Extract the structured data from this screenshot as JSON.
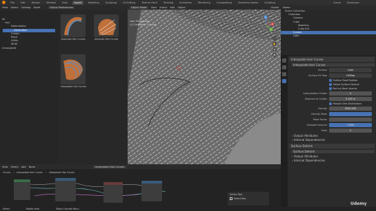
{
  "topbar": {
    "menus": [
      "File",
      "Edit",
      "Render",
      "Window",
      "Help"
    ],
    "tabs": [
      "Layout",
      "Modeling",
      "Sculpting",
      "UV Editing",
      "Texture Paint",
      "Shading",
      "Animation",
      "Rendering",
      "Compositing",
      "Geometry Nodes",
      "Scripting"
    ],
    "active_tab": "Layout",
    "scene": "Scene",
    "view_layer": "ViewLayer"
  },
  "asset_browser": {
    "header_items": [
      "View",
      "Select",
      "Catalog",
      "Asset"
    ],
    "follow_prefs": "Follow Preferences",
    "tree": [
      {
        "label": "All",
        "indent": 0
      },
      {
        "label": "Hair",
        "indent": 1
      },
      {
        "label": "Deformation",
        "indent": 2
      },
      {
        "label": "Generation",
        "indent": 2,
        "selected": true
      },
      {
        "label": "Guides",
        "indent": 2
      },
      {
        "label": "Read",
        "indent": 2
      },
      {
        "label": "Utility",
        "indent": 2
      },
      {
        "label": "Write",
        "indent": 2
      },
      {
        "label": "Unassigned",
        "indent": 0
      }
    ],
    "assets": [
      "Duplicate Hair Curves",
      "Generate Hair Curves",
      "Interpolate Hair Curves"
    ]
  },
  "viewport": {
    "mode": "Object Mode",
    "menus": [
      "View",
      "Select",
      "Add",
      "Object"
    ],
    "transform": "Global",
    "perspective": "User Perspective",
    "collection": "(1) Collection | Curves",
    "axes": {
      "x": "X",
      "y": "Y",
      "z": "Z"
    }
  },
  "outliner": {
    "title": "Name",
    "items": [
      {
        "label": "Scene Collection",
        "indent": 0
      },
      {
        "label": "Collection",
        "indent": 1
      },
      {
        "label": "Camera",
        "indent": 2
      },
      {
        "label": "Cube",
        "indent": 2
      },
      {
        "label": "Modifiers",
        "indent": 3
      },
      {
        "label": "Cube.001",
        "indent": 3
      },
      {
        "label": "Curves",
        "indent": 2,
        "selected": true
      },
      {
        "label": "Light",
        "indent": 2
      }
    ]
  },
  "properties": {
    "modifier_name": "Interpolate Hair Curves",
    "sub_name": "Interpolate Hair Curves",
    "surface_label": "Surface",
    "surface_value": "Cube",
    "uv_label": "Surface UV Map",
    "uv_value": "UVMap",
    "checks": [
      "Surface Root Position",
      "Follow Surface Normal",
      "Part by Mesh Islands"
    ],
    "interp_label": "Interpolation Guides",
    "interp_value": "4",
    "dist_label": "Distance to Guides",
    "dist_value": "0.100 m",
    "poisson": "Poisson Disk Distribution",
    "density_label": "Density",
    "density_value": "5000.000",
    "density_mask_label": "Density Mask",
    "mask_factor_label": "Mask Factor",
    "viewport_amount_label": "Viewport Amount",
    "viewport_amount_value": "1.000",
    "seed_label": "Seed",
    "seed_value": "0",
    "output_attributes": "Output Attributes",
    "internal_deps": "Internal Dependencies",
    "surface_deform": "Surface Deform",
    "sd_sub": "Surface Deform"
  },
  "node_editor": {
    "menus": [
      "View",
      "Select",
      "Add",
      "Node"
    ],
    "node_group": "Interpolate Hair Curves",
    "breadcrumbs": [
      "Curves",
      "Interpolate Hair Curves",
      "Interpolate Hair Curves"
    ],
    "active_tool": "Active Tool",
    "select_box": "Select Box"
  },
  "statusbar": {
    "items": [
      "Select",
      "Rotate View",
      "Object Context Menu"
    ]
  },
  "watermark": "Udemy"
}
